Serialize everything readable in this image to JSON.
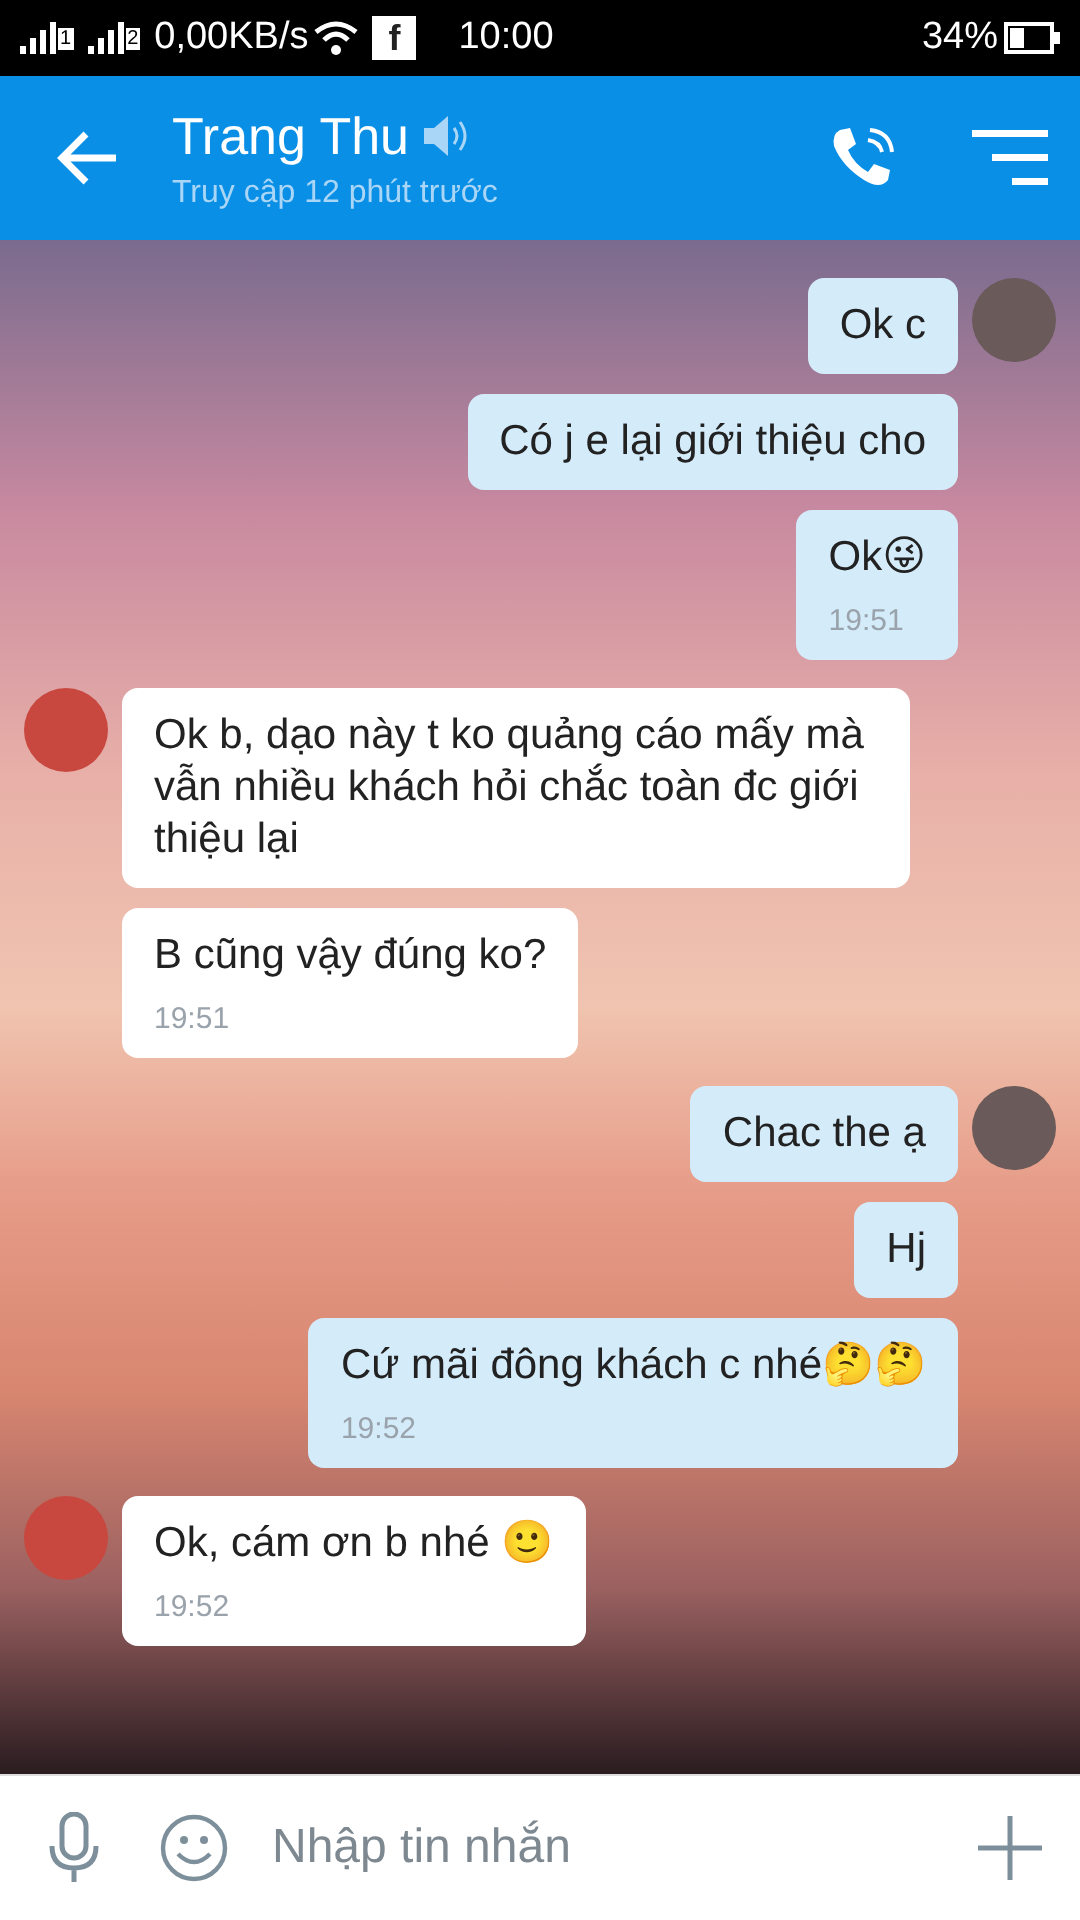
{
  "status_bar": {
    "network_speed": "0,00KB/s",
    "time": "10:00",
    "battery": "34%",
    "sim_1": "1",
    "sim_2": "2",
    "app_icon": "f"
  },
  "header": {
    "title": "Trang Thu",
    "subtitle": "Truy cập 12 phút trước"
  },
  "messages": [
    {
      "kind": "sent",
      "avatar": true,
      "text": "Ok c"
    },
    {
      "kind": "sent",
      "avatar": false,
      "text": "Có j e lại giới thiệu cho"
    },
    {
      "kind": "sent",
      "avatar": false,
      "text": "Ok😜",
      "time": "19:51"
    },
    {
      "kind": "received",
      "avatar": true,
      "text": "Ok b, dạo này t ko quảng cáo mấy mà vẫn nhiều khách hỏi chắc toàn đc giới thiệu lại"
    },
    {
      "kind": "received",
      "avatar": false,
      "text": "B cũng vậy đúng ko?",
      "time": "19:51"
    },
    {
      "kind": "sent",
      "avatar": true,
      "text": "Chac the ạ"
    },
    {
      "kind": "sent",
      "avatar": false,
      "text": "Hj"
    },
    {
      "kind": "sent",
      "avatar": false,
      "text": "Cứ mãi đông khách c nhé🤔🤔",
      "time": "19:52"
    },
    {
      "kind": "received",
      "avatar": true,
      "text": "Ok, cám ơn b nhé 🙂",
      "time": "19:52"
    }
  ],
  "composer": {
    "placeholder": "Nhập tin nhắn"
  }
}
